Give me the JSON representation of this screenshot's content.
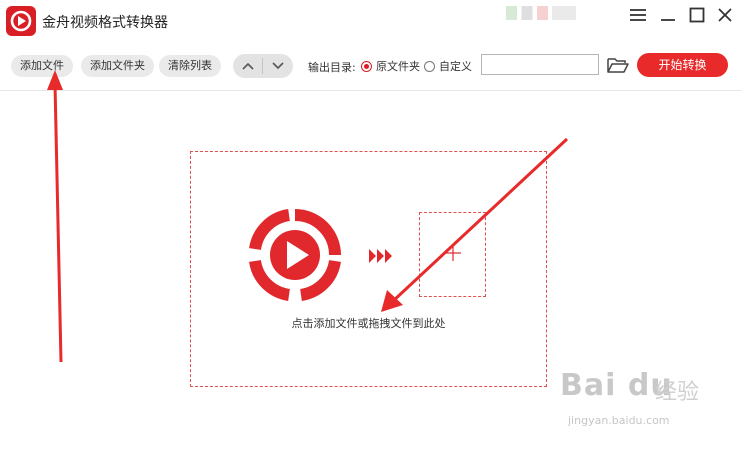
{
  "app": {
    "title": "金舟视频格式转换器",
    "icon": "app-logo-icon",
    "brand_color": "#d81f26"
  },
  "window_controls": [
    "menu-icon",
    "minimize-icon",
    "maximize-icon",
    "close-icon"
  ],
  "toolbar": {
    "add_file": "添加文件",
    "add_folder": "添加文件夹",
    "clear_list": "清除列表",
    "move_up": "chevron-up-icon",
    "move_down": "chevron-down-icon",
    "output_label": "输出目录:",
    "output_options": [
      {
        "label": "原文件夹",
        "selected": true
      },
      {
        "label": "自定义",
        "selected": false
      }
    ],
    "output_path_value": "",
    "folder_icon": "folder-open-icon",
    "start_label": "开始转换",
    "start_color": "#e82a2a"
  },
  "drop_area": {
    "hint": "点击添加文件或拖拽文件到此处",
    "icons": [
      "video-convert-icon",
      "triple-arrow-icon",
      "plus-icon"
    ],
    "border_color": "#e05050"
  },
  "annotations": {
    "arrow_color": "#e82a2a"
  },
  "watermark": {
    "logo": "Bai du",
    "sub": "经验",
    "url": "jingyan.baidu.com"
  }
}
